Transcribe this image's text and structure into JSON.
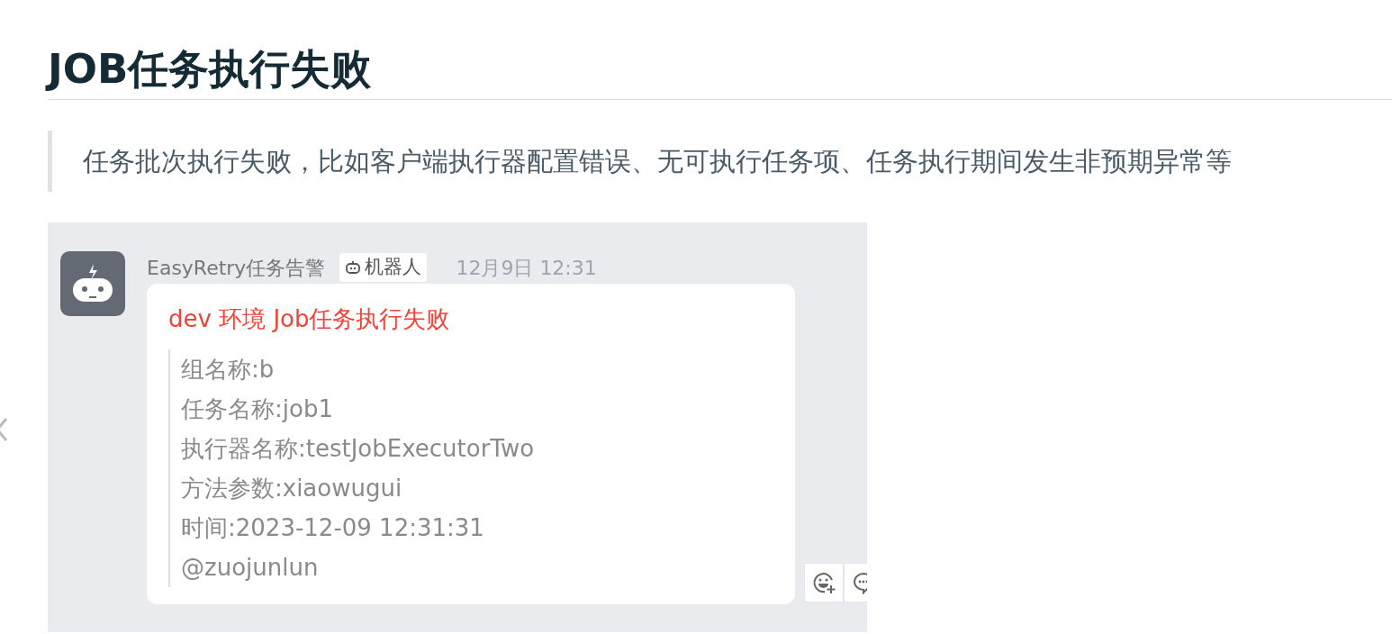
{
  "heading": "JOB任务执行失败",
  "quote": "任务批次执行失败，比如客户端执行器配置错误、无可执行任务项、任务执行期间发生非预期异常等",
  "message": {
    "sender": "EasyRetry任务告警",
    "tag": "机器人",
    "time": "12月9日 12:31",
    "title": "dev 环境 Job任务执行失败",
    "lines": [
      "组名称:b",
      "任务名称:job1",
      "执行器名称:testJobExecutorTwo",
      "方法参数:xiaowugui",
      "时间:2023-12-09 12:31:31",
      "@zuojunlun"
    ]
  }
}
